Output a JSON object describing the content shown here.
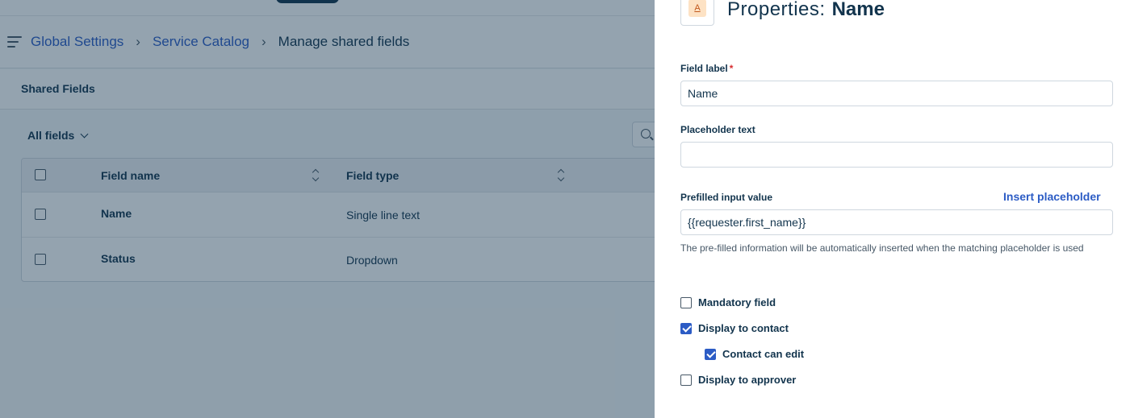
{
  "breadcrumb": {
    "items": [
      "Global Settings",
      "Service Catalog",
      "Manage shared fields"
    ],
    "separator": "›"
  },
  "subheader": {
    "title": "Shared Fields"
  },
  "filter": {
    "label": "All fields"
  },
  "table": {
    "columns": [
      "Field name",
      "Field type"
    ],
    "rows": [
      {
        "name": "Name",
        "type": "Single line text"
      },
      {
        "name": "Status",
        "type": "Dropdown"
      }
    ]
  },
  "panel": {
    "icon_letter": "A",
    "title_prefix": "Properties:",
    "title_name": "Name",
    "field_label": {
      "label": "Field label",
      "required_mark": "*",
      "value": "Name"
    },
    "placeholder_text": {
      "label": "Placeholder text",
      "value": ""
    },
    "prefilled": {
      "label": "Prefilled input value",
      "insert_link": "Insert placeholder",
      "value": "{{requester.first_name}}",
      "hint": "The pre-filled information will be automatically inserted when the matching placeholder is used"
    },
    "options": [
      {
        "label": "Mandatory field",
        "checked": false
      },
      {
        "label": "Display to contact",
        "checked": true
      },
      {
        "label": "Contact can edit",
        "checked": true
      },
      {
        "label": "Display to approver",
        "checked": false
      }
    ]
  },
  "colors": {
    "primary": "#2c5cc5",
    "text": "#12344d",
    "overlay": "rgba(18, 52, 77, 0.45)",
    "required": "#d72d30"
  }
}
